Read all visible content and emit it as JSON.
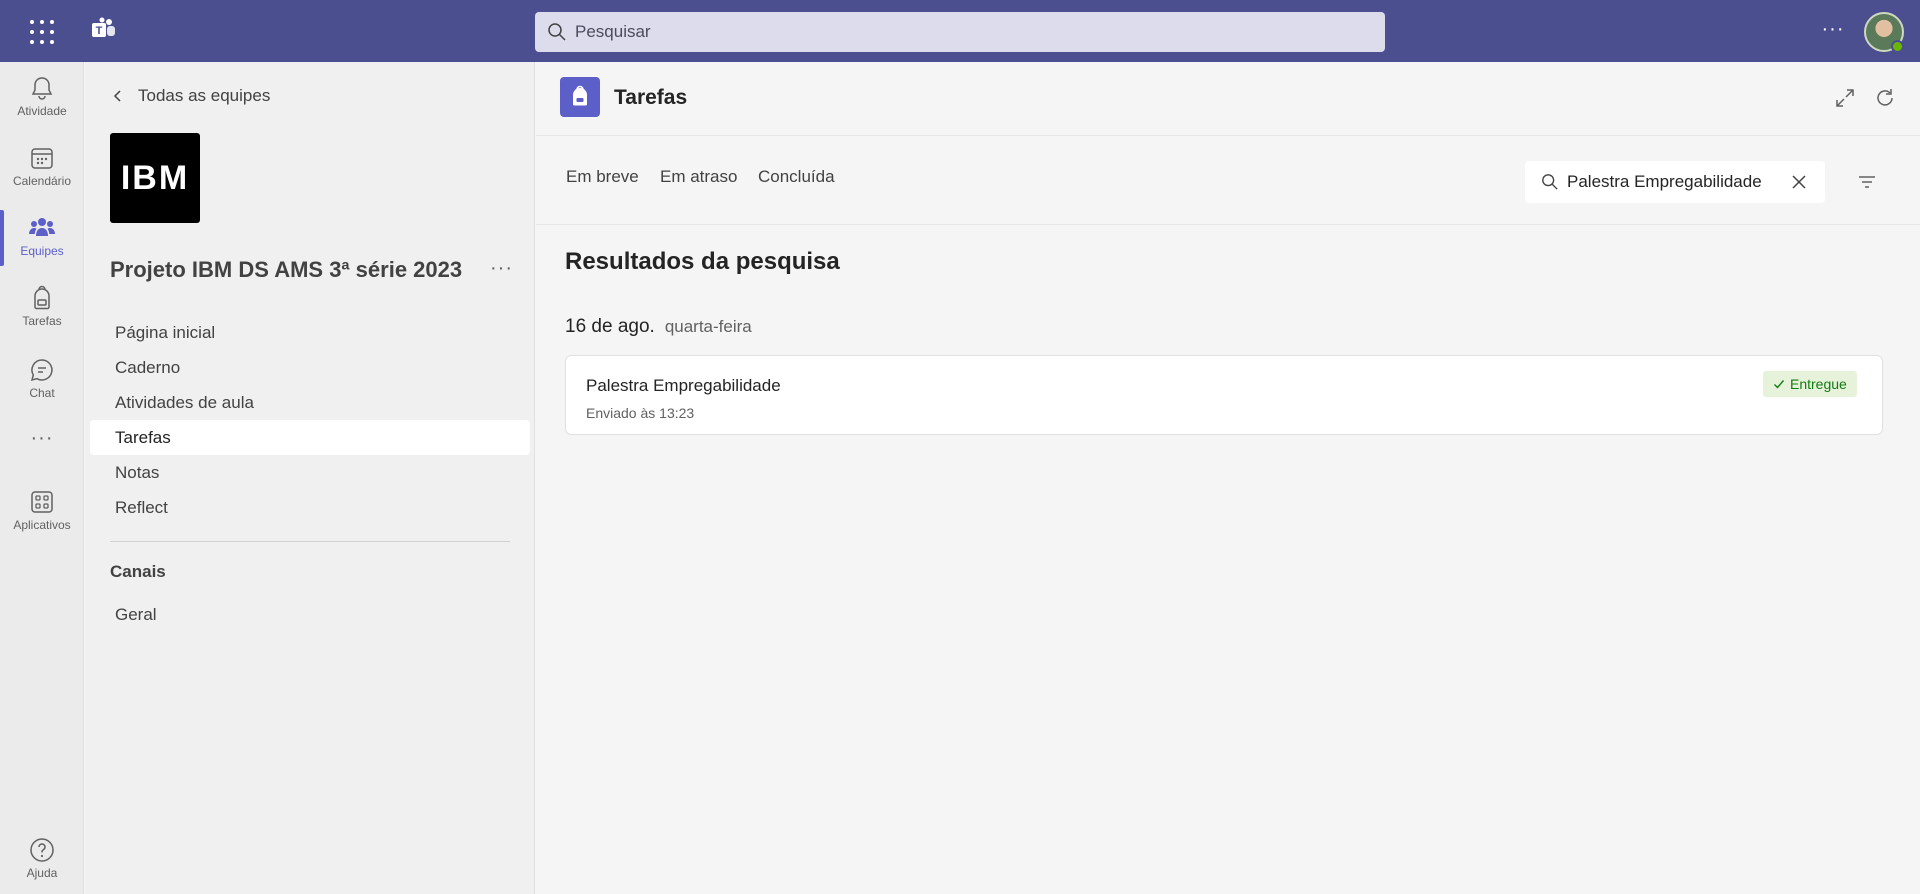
{
  "topbar": {
    "search_placeholder": "Pesquisar"
  },
  "rail": {
    "items": [
      {
        "label": "Atividade",
        "icon": "bell-icon"
      },
      {
        "label": "Calendário",
        "icon": "calendar-icon"
      },
      {
        "label": "Equipes",
        "icon": "teams-icon",
        "active": true
      },
      {
        "label": "Tarefas",
        "icon": "backpack-icon"
      },
      {
        "label": "Chat",
        "icon": "chat-icon"
      },
      {
        "label": "Aplicativos",
        "icon": "apps-icon"
      }
    ],
    "help_label": "Ajuda"
  },
  "team": {
    "back_label": "Todas as equipes",
    "logo_text": "IBM",
    "name": "Projeto IBM DS AMS 3ª série 2023",
    "nav": [
      "Página inicial",
      "Caderno",
      "Atividades de aula",
      "Tarefas",
      "Notas",
      "Reflect"
    ],
    "active_nav": "Tarefas",
    "channels_heading": "Canais",
    "channels": [
      "Geral"
    ]
  },
  "main": {
    "title": "Tarefas",
    "tabs": [
      "Em breve",
      "Em atraso",
      "Concluída"
    ],
    "search_value": "Palestra Empregabilidade",
    "results_heading": "Resultados da pesquisa",
    "date": "16 de ago.",
    "weekday": "quarta-feira",
    "assignment": {
      "title": "Palestra Empregabilidade",
      "subtitle": "Enviado às 13:23",
      "status": "Entregue"
    }
  },
  "colors": {
    "topbar": "#4b4f8f",
    "accent": "#5b5fc7",
    "success": "#107c10",
    "success_bg": "#e7f2da"
  }
}
